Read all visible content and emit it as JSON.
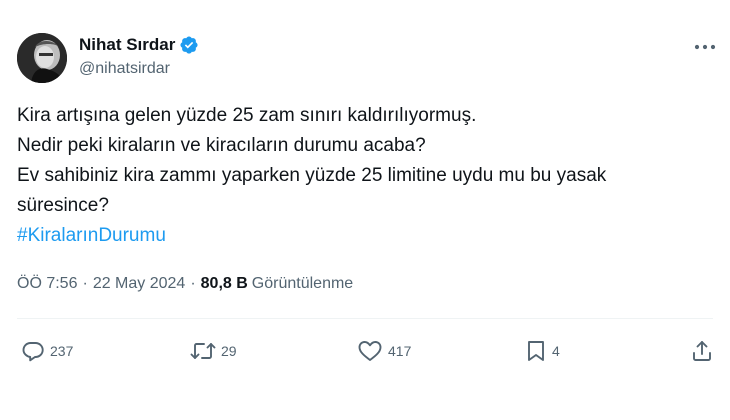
{
  "author": {
    "display_name": "Nihat Sırdar",
    "handle": "@nihatsirdar",
    "avatar_icon": "profile-photo",
    "verified_icon": "verified-badge-icon",
    "verified_color": "#1d9bf0"
  },
  "menu": {
    "icon": "more-horizontal-icon"
  },
  "tweet": {
    "lines": [
      "Kira artışına gelen yüzde 25 zam sınırı kaldırılıyormuş.",
      "Nedir peki kiraların ve kiracıların durumu acaba?",
      "Ev sahibiniz kira zammı yaparken yüzde 25 limitine uydu mu bu yasak",
      "süresince?"
    ],
    "hashtag": "#KiralarınDurumu",
    "hashtag_color": "#1d9bf0"
  },
  "meta": {
    "time": "ÖÖ 7:56",
    "separator": "·",
    "date": "22 May 2024",
    "views_count": "80,8 B",
    "views_label": "Görüntülenme"
  },
  "actions": {
    "reply": {
      "icon": "reply-icon",
      "count": "237"
    },
    "retweet": {
      "icon": "retweet-icon",
      "count": "29"
    },
    "like": {
      "icon": "heart-icon",
      "count": "417"
    },
    "bookmark": {
      "icon": "bookmark-icon",
      "count": "4"
    },
    "share": {
      "icon": "share-icon"
    }
  },
  "colors": {
    "text": "#0f1419",
    "secondary": "#536471",
    "divider": "#eff3f4"
  }
}
